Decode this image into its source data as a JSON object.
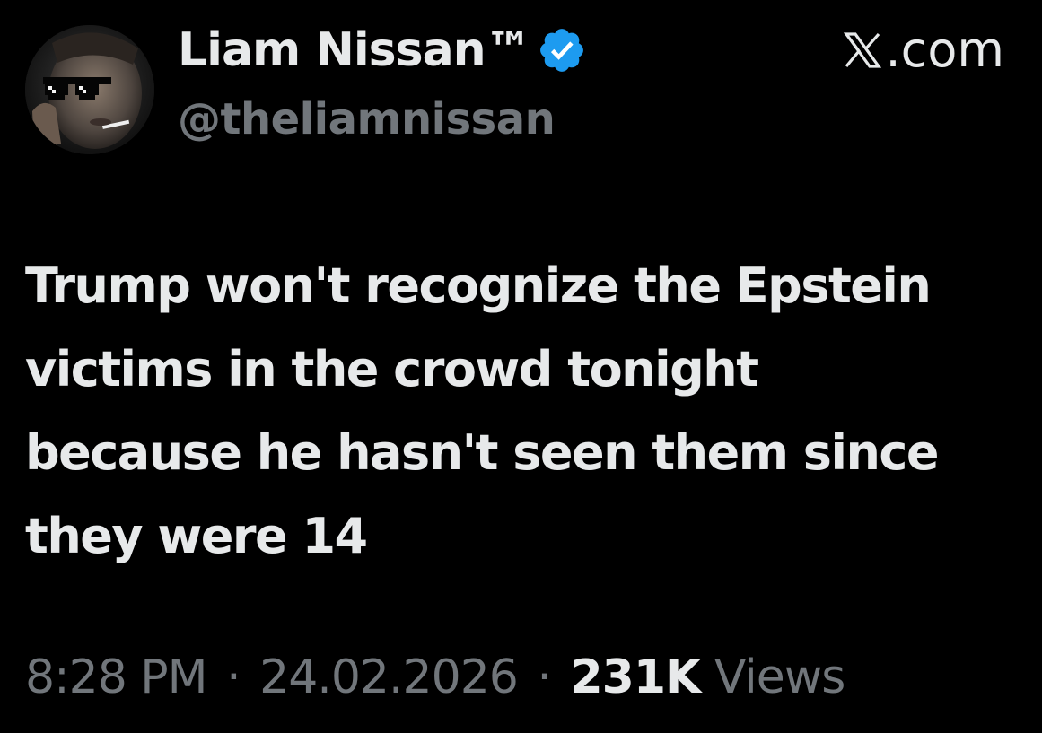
{
  "author": {
    "display_name": "Liam Nissan™",
    "handle": "@theliamnissan",
    "verified": true,
    "verified_color": "#1d9bf0",
    "avatar_icon": "avatar-photo-sunglasses"
  },
  "brand": {
    "label": ".com",
    "icon": "x-logo-icon"
  },
  "tweet": {
    "text": "Trump won't recognize the Epstein victims in the crowd tonight because he hasn't seen them since they were 14"
  },
  "meta": {
    "time": "8:28 PM",
    "separator": "·",
    "date": "24.02.2026",
    "views_count": "231K",
    "views_label": "Views"
  },
  "colors": {
    "background": "#000000",
    "primary_text": "#e7e9ea",
    "secondary_text": "#71767b"
  }
}
